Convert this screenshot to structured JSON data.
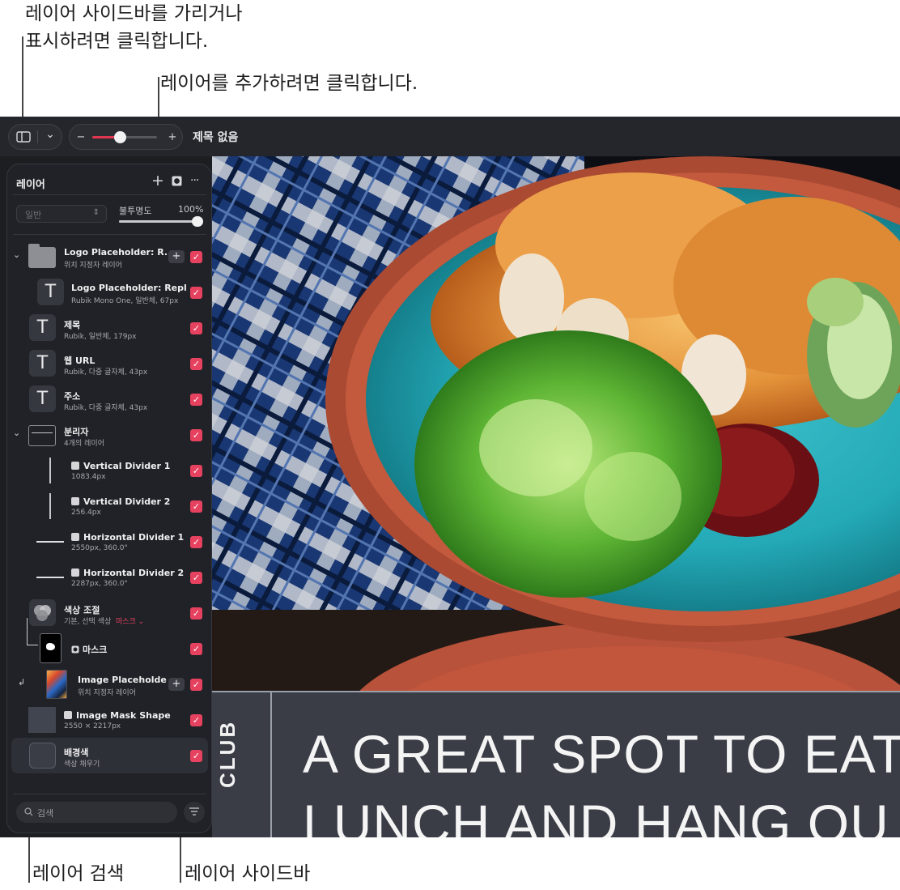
{
  "callouts": {
    "sidebar_toggle": "레이어 사이드바를 가리거나\n표시하려면 클릭합니다.",
    "add_layer": "레이어를 추가하려면 클릭합니다.",
    "search_layers": "레이어 검색",
    "layers_sidebar": "레이어 사이드바"
  },
  "toolbar": {
    "sidebar_icon": "sidebar-icon",
    "chevron": "⌄",
    "zoom_minus": "−",
    "zoom_plus": "+",
    "zoom_level": 0.42,
    "document_title": "제목 없음"
  },
  "layers_panel": {
    "title": "레이어",
    "add_icon": "+",
    "mask_icon": "◘",
    "more_icon": "···",
    "blend_mode": "일반",
    "blend_chevron": "⌃⌄",
    "opacity_label": "불투명도",
    "opacity_value": "100%",
    "opacity_level": 1.0,
    "layers": [
      {
        "name": "Logo Placeholder: R...",
        "sub": "위치 지정자 레이어",
        "kind": "folder",
        "checked": true,
        "has_plus": true,
        "chevron": "⌄"
      },
      {
        "name": "Logo Placeholder: Repl...",
        "sub": "Rubik Mono One, 일반체, 67px",
        "kind": "text",
        "thumb": "T",
        "checked": true
      },
      {
        "name": "제목",
        "sub": "Rubik, 일반체, 179px",
        "kind": "text",
        "thumb": "T",
        "checked": true
      },
      {
        "name": "웹 URL",
        "sub": "Rubik, 다중 글자체, 43px",
        "kind": "text",
        "thumb": "T",
        "checked": true
      },
      {
        "name": "주소",
        "sub": "Rubik, 다중 글자체, 43px",
        "kind": "text",
        "thumb": "T",
        "checked": true
      },
      {
        "name": "분리자",
        "sub": "4개의 레이어",
        "kind": "folder",
        "checked": true,
        "chevron": "⌄"
      },
      {
        "name": "Vertical Divider 1",
        "sub": "1083.4px",
        "kind": "vline",
        "checked": true
      },
      {
        "name": "Vertical Divider 2",
        "sub": "256.4px",
        "kind": "vline",
        "checked": true
      },
      {
        "name": "Horizontal Divider 1",
        "sub": "2550px, 360.0°",
        "kind": "hline",
        "checked": true
      },
      {
        "name": "Horizontal Divider 2",
        "sub": "2287px, 360.0°",
        "kind": "hline",
        "checked": true
      },
      {
        "name": "색상 조절",
        "sub": "기본, 선택 색상",
        "sub_extra": "마스크 ⌄",
        "kind": "adjust",
        "checked": true
      },
      {
        "name": "마스크",
        "kind": "mask",
        "checked": true
      },
      {
        "name": "Image Placeholde...",
        "sub": "위치 지정자 레이어",
        "kind": "image",
        "checked": true,
        "has_plus": true
      },
      {
        "name": "Image Mask Shape",
        "sub": "2550 × 2217px",
        "kind": "shape",
        "checked": true
      },
      {
        "name": "배경색",
        "sub": "색상 채우기",
        "kind": "fill",
        "checked": true,
        "selected": true
      }
    ],
    "search_placeholder": "검색",
    "search_icon": "magnifier-icon",
    "filter_icon": "filter-icon"
  },
  "canvas": {
    "vertical_text": "CLUB",
    "headline_line1": "A GREAT SPOT TO EAT",
    "headline_line2": "LUNCH AND HANG OU"
  },
  "colors": {
    "accent": "#e6415f",
    "sidebar_bg": "#202227",
    "app_bg": "#1c1e22",
    "banner_bg": "#3a3d46"
  }
}
